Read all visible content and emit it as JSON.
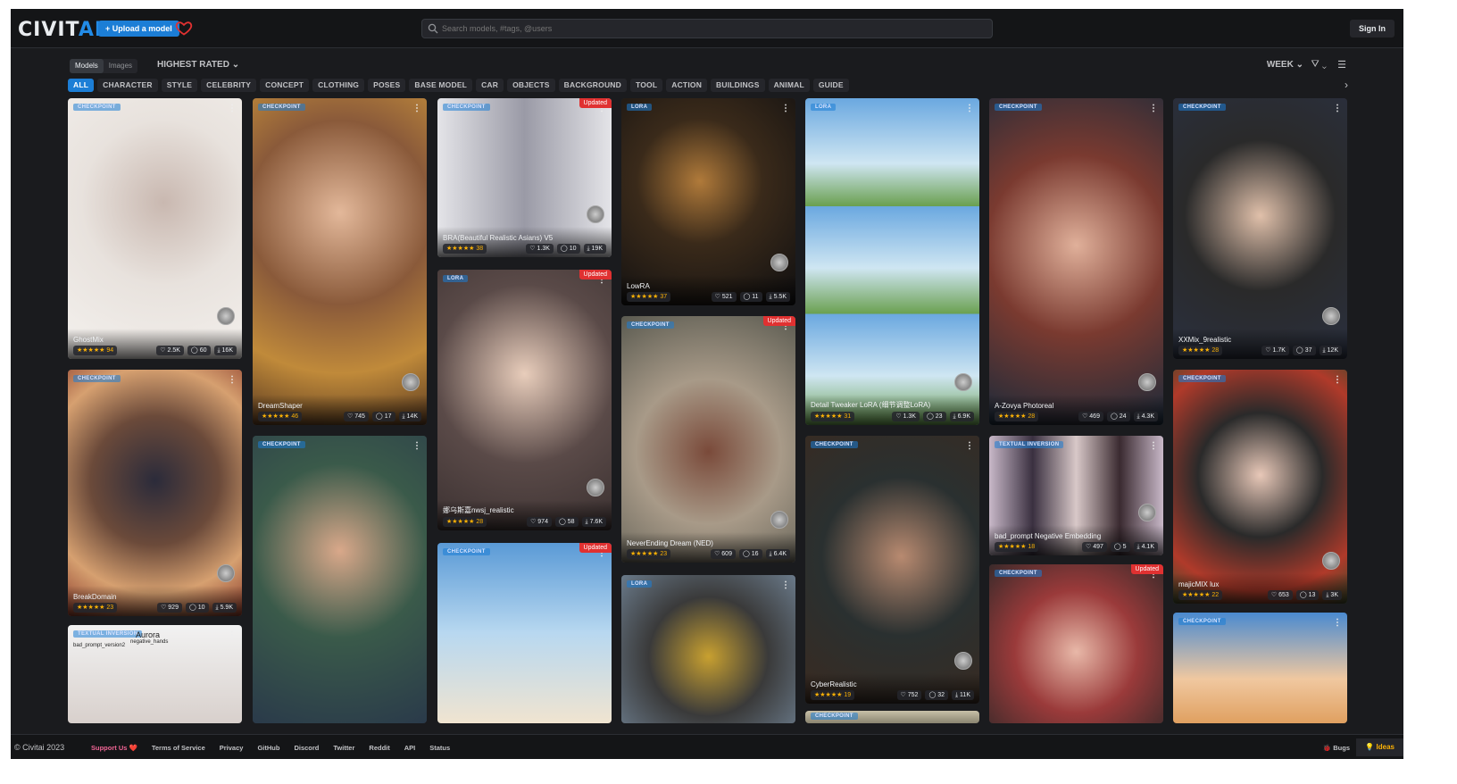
{
  "header": {
    "logo_main": "CIVIT",
    "logo_ai": "AI",
    "upload_label": "+ Upload a model",
    "search_placeholder": "Search models, #tags, @users",
    "signin_label": "Sign In"
  },
  "toolbar": {
    "seg_models": "Models",
    "seg_images": "Images",
    "sort_label": "HIGHEST RATED ⌄",
    "period_label": "WEEK ⌄",
    "filter_icon": "⛛ ⌄",
    "layout_icon": "☰",
    "next_icon": "›"
  },
  "tags": [
    "ALL",
    "CHARACTER",
    "STYLE",
    "CELEBRITY",
    "CONCEPT",
    "CLOTHING",
    "POSES",
    "BASE MODEL",
    "CAR",
    "OBJECTS",
    "BACKGROUND",
    "TOOL",
    "ACTION",
    "BUILDINGS",
    "ANIMAL",
    "GUIDE"
  ],
  "cards": [
    {
      "type": "CHECKPOINT",
      "name": "GhostMix",
      "rating": "★★★★★ 94",
      "likes": "♡ 2.5K",
      "comments": "◯ 60",
      "downloads": "⤓ 16K",
      "updated": ""
    },
    {
      "type": "CHECKPOINT",
      "name": "BreakDomain",
      "rating": "★★★★★ 23",
      "likes": "♡ 929",
      "comments": "◯ 10",
      "downloads": "⤓ 5.9K",
      "updated": ""
    },
    {
      "type": "TEXTUAL INVERSION",
      "name": "",
      "rating": "",
      "likes": "",
      "comments": "",
      "downloads": "",
      "updated": "",
      "caption1": "bad_prompt_version2",
      "caption2": "Aurora",
      "caption3": "negative_hands"
    },
    {
      "type": "CHECKPOINT",
      "name": "DreamShaper",
      "rating": "★★★★★ 46",
      "likes": "♡ 745",
      "comments": "◯ 17",
      "downloads": "⤓ 14K",
      "updated": ""
    },
    {
      "type": "CHECKPOINT",
      "name": "",
      "rating": "",
      "likes": "",
      "comments": "",
      "downloads": "",
      "updated": ""
    },
    {
      "type": "CHECKPOINT",
      "name": "BRA(Beautiful Realistic Asians) V5",
      "rating": "★★★★★ 38",
      "likes": "♡ 1.3K",
      "comments": "◯ 10",
      "downloads": "⤓ 19K",
      "updated": "Updated"
    },
    {
      "type": "LORA",
      "name": "娜乌斯嘉nwsj_realistic",
      "rating": "★★★★★ 28",
      "likes": "♡ 974",
      "comments": "◯ 58",
      "downloads": "⤓ 7.6K",
      "updated": "Updated"
    },
    {
      "type": "CHECKPOINT",
      "name": "",
      "rating": "",
      "likes": "",
      "comments": "",
      "downloads": "",
      "updated": "Updated"
    },
    {
      "type": "LORA",
      "name": "LowRA",
      "rating": "★★★★★ 37",
      "likes": "♡ 521",
      "comments": "◯ 11",
      "downloads": "⤓ 5.5K",
      "updated": ""
    },
    {
      "type": "CHECKPOINT",
      "name": "NeverEnding Dream (NED)",
      "rating": "★★★★★ 23",
      "likes": "♡ 609",
      "comments": "◯ 16",
      "downloads": "⤓ 6.4K",
      "updated": "Updated"
    },
    {
      "type": "LORA",
      "name": "",
      "rating": "",
      "likes": "",
      "comments": "",
      "downloads": "",
      "updated": ""
    },
    {
      "type": "LORA",
      "name": "Detail Tweaker LoRA (细节调整LoRA)",
      "rating": "★★★★★ 31",
      "likes": "♡ 1.3K",
      "comments": "◯ 23",
      "downloads": "⤓ 6.9K",
      "updated": ""
    },
    {
      "type": "CHECKPOINT",
      "name": "CyberRealistic",
      "rating": "★★★★★ 19",
      "likes": "♡ 752",
      "comments": "◯ 32",
      "downloads": "⤓ 11K",
      "updated": ""
    },
    {
      "type": "CHECKPOINT",
      "name": "",
      "rating": "",
      "likes": "",
      "comments": "",
      "downloads": "",
      "updated": ""
    },
    {
      "type": "CHECKPOINT",
      "name": "A-Zovya Photoreal",
      "rating": "★★★★★ 28",
      "likes": "♡ 469",
      "comments": "◯ 24",
      "downloads": "⤓ 4.3K",
      "updated": ""
    },
    {
      "type": "TEXTUAL INVERSION",
      "name": "bad_prompt Negative Embedding",
      "rating": "★★★★★ 18",
      "likes": "♡ 497",
      "comments": "◯ 5",
      "downloads": "⤓ 4.1K",
      "updated": ""
    },
    {
      "type": "CHECKPOINT",
      "name": "",
      "rating": "",
      "likes": "",
      "comments": "",
      "downloads": "",
      "updated": "Updated"
    },
    {
      "type": "CHECKPOINT",
      "name": "XXMix_9realistic",
      "rating": "★★★★★ 28",
      "likes": "♡ 1.7K",
      "comments": "◯ 37",
      "downloads": "⤓ 12K",
      "updated": ""
    },
    {
      "type": "CHECKPOINT",
      "name": "majicMIX lux",
      "rating": "★★★★★ 22",
      "likes": "♡ 653",
      "comments": "◯ 13",
      "downloads": "⤓ 3K",
      "updated": ""
    },
    {
      "type": "CHECKPOINT",
      "name": "",
      "rating": "",
      "likes": "",
      "comments": "",
      "downloads": "",
      "updated": ""
    }
  ],
  "footer": {
    "copyright": "© Civitai 2023",
    "links": [
      "Support Us ❤️",
      "Terms of Service",
      "Privacy",
      "GitHub",
      "Discord",
      "Twitter",
      "Reddit",
      "API",
      "Status"
    ],
    "bugs": "🐞 Bugs",
    "ideas": "💡 Ideas"
  },
  "colors": {
    "accent": "#1c7ed6",
    "background": "#1a1b1e",
    "updated": "#e03131",
    "star": "#fab005"
  }
}
